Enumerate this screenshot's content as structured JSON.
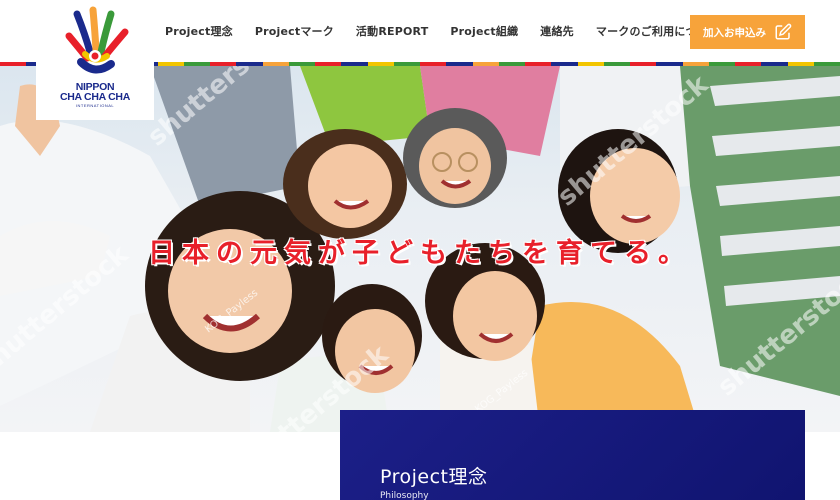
{
  "logo": {
    "line1": "NIPPON",
    "line2": "CHA CHA CHA",
    "line3": "INTERNATIONAL"
  },
  "nav": {
    "items": [
      {
        "label": "Project理念"
      },
      {
        "label": "Projectマーク"
      },
      {
        "label": "活動REPORT"
      },
      {
        "label": "Project組織"
      },
      {
        "label": "連絡先"
      },
      {
        "label": "マークのご利用について"
      }
    ],
    "join_button": "加入お申込み"
  },
  "hero": {
    "tagline": "日本の元気が子どもたちを育てる。",
    "watermarks": [
      "shutterstock",
      "shutterstock",
      "shutterstock",
      "shutterstock",
      "shutterstock"
    ],
    "credits": [
      "KOG_Payless",
      "KOG_Payless"
    ]
  },
  "project": {
    "title": "Project理念",
    "subtitle": "Philosophy"
  },
  "colors": {
    "accent_orange": "#f7a33a",
    "navy": "#1c1f88",
    "tagline_red": "#e8202a",
    "stripe": [
      "#e8202a",
      "#1a2a8c",
      "#f7a33a",
      "#3a9a3a",
      "#e8202a",
      "#1a2a8c",
      "#f2c500",
      "#3a9a3a"
    ]
  },
  "icons": {
    "join": "pen-square-icon"
  }
}
